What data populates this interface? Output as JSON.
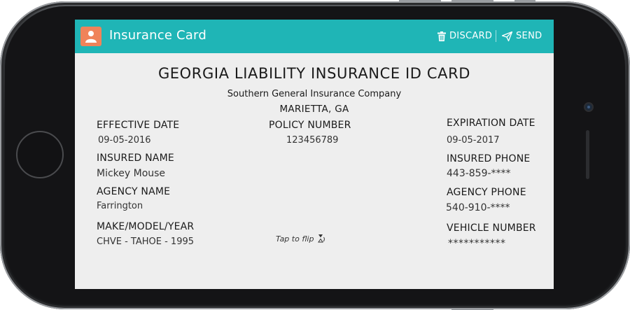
{
  "app_bar": {
    "title": "Insurance Card",
    "discard_label": "DISCARD",
    "send_label": "SEND",
    "color": "#1fb5b6",
    "avatar_color": "#f0835a"
  },
  "card": {
    "title": "GEORGIA LIABILITY INSURANCE ID CARD",
    "company": "Southern General Insurance Company",
    "location": "MARIETTA, GA",
    "effective_date_label": "EFFECTIVE DATE",
    "effective_date": "09-05-2016",
    "policy_number_label": "POLICY NUMBER",
    "policy_number": "123456789",
    "expiration_date_label": "EXPIRATION DATE",
    "expiration_date": "09-05-2017",
    "insured_name_label": "INSURED NAME",
    "insured_name": "Mickey Mouse",
    "insured_phone_label": "INSURED PHONE",
    "insured_phone": "443-859-****",
    "agency_name_label": "AGENCY NAME",
    "agency_name": "Farrington",
    "agency_phone_label": "AGENCY PHONE",
    "agency_phone": "540-910-****",
    "make_model_year_label": "MAKE/MODEL/YEAR",
    "make_model_year": "CHVE - TAHOE - 1995",
    "vehicle_number_label": "VEHICLE NUMBER",
    "vehicle_number": "***********",
    "tap_to_flip": "Tap to flip"
  },
  "icons": {
    "avatar": "person-icon",
    "discard": "trash-icon",
    "send": "send-icon",
    "flip": "flip-icon"
  }
}
